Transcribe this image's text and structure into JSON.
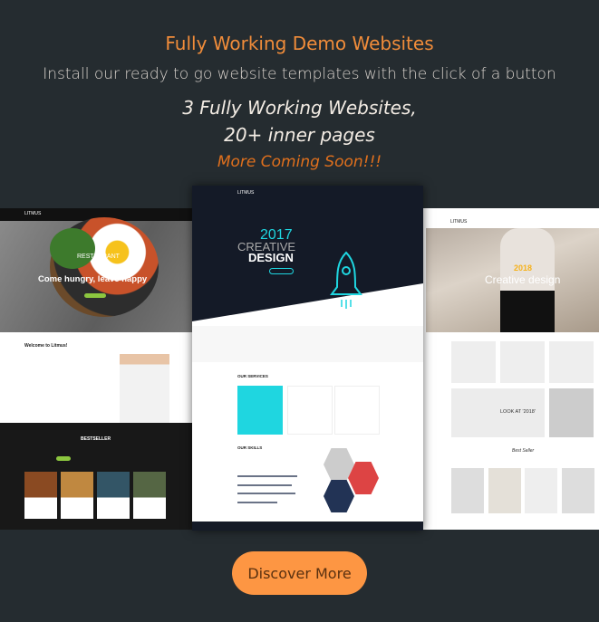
{
  "header": {
    "title": "Fully Working Demo Websites",
    "subtitle": "Install our ready to go website templates with the click of a button",
    "highlight_line1": "3 Fully Working Websites,",
    "highlight_line2": "20+ inner pages",
    "coming_soon": "More Coming Soon!!!"
  },
  "cta": {
    "label": "Discover More"
  },
  "demos": {
    "restaurant": {
      "logo": "LITMUS",
      "hero_tag": "RESTAURANT",
      "hero_title": "Come hungry, leave happy",
      "welcome": "Welcome to Litmus!",
      "section": "BESTSELLER"
    },
    "creative": {
      "logo": "LITMUS",
      "year": "2017",
      "line1": "CREATIVE",
      "line2": "DESIGN",
      "services": "OUR SERVICES",
      "skills": "OUR SKILLS"
    },
    "fashion": {
      "logo": "LITMUS",
      "year": "2018",
      "hero": "Creative design",
      "banner": "LOOK AT '2018'",
      "section": "Best Seller"
    }
  },
  "colors": {
    "background": "#252c30",
    "accent_orange": "#fd9643",
    "restaurant_green": "#8cc63f",
    "creative_cyan": "#1fd6e0",
    "fashion_yellow": "#f6b21c"
  }
}
